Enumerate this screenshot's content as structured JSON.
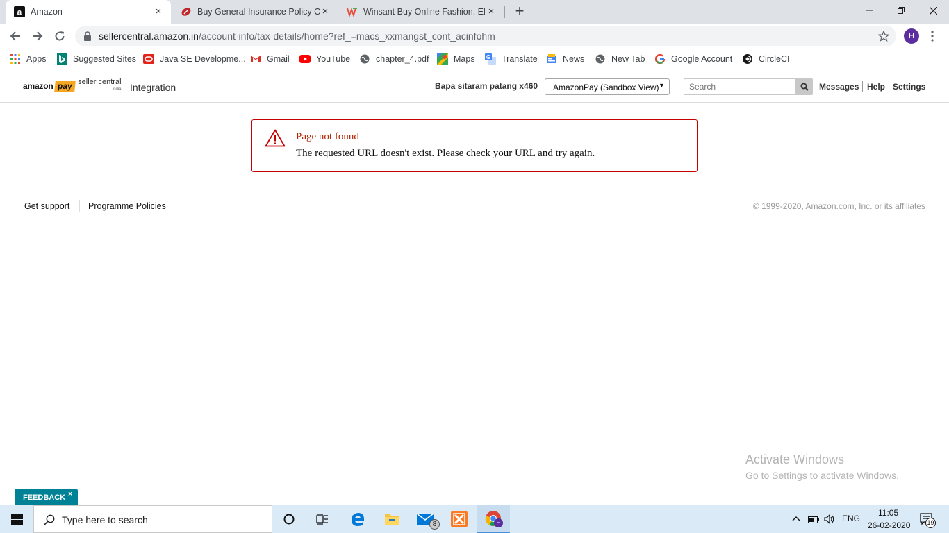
{
  "browser": {
    "tabs": [
      {
        "title": "Amazon",
        "active": true
      },
      {
        "title": "Buy General Insurance Policy Onl",
        "active": false
      },
      {
        "title": "Winsant Buy Online Fashion, Elec",
        "active": false
      }
    ],
    "new_tab_label": "+",
    "close_label": "×",
    "url_host": "sellercentral.amazon.in",
    "url_path": "/account-info/tax-details/home?ref_=macs_xxmangst_cont_acinfohm",
    "profile_initial": "H",
    "bookmarks": [
      {
        "label": "Apps",
        "icon": "apps-grid-icon"
      },
      {
        "label": "Suggested Sites",
        "icon": "bing-icon"
      },
      {
        "label": "Java SE Developme...",
        "icon": "oracle-icon"
      },
      {
        "label": "Gmail",
        "icon": "gmail-icon"
      },
      {
        "label": "YouTube",
        "icon": "youtube-icon"
      },
      {
        "label": "chapter_4.pdf",
        "icon": "globe-icon"
      },
      {
        "label": "Maps",
        "icon": "maps-icon"
      },
      {
        "label": "Translate",
        "icon": "translate-icon"
      },
      {
        "label": "News",
        "icon": "news-icon"
      },
      {
        "label": "New Tab",
        "icon": "globe-icon"
      },
      {
        "label": "Google Account",
        "icon": "google-icon"
      },
      {
        "label": "CircleCI",
        "icon": "circleci-icon"
      }
    ]
  },
  "header": {
    "logo_amazon": "amazon",
    "logo_pay": "pay",
    "logo_seller_central": "seller central",
    "logo_region": "India",
    "integration_label": "Integration",
    "account_name": "Bapa sitaram patang x460",
    "marketplace_selected": "AmazonPay (Sandbox View)",
    "search_placeholder": "Search",
    "links": [
      "Messages",
      "Help",
      "Settings"
    ]
  },
  "alert": {
    "title": "Page not found",
    "message": "The requested URL doesn't exist. Please check your URL and try again."
  },
  "footer": {
    "links": [
      "Get support",
      "Programme Policies"
    ],
    "copyright": "© 1999-2020, Amazon.com, Inc. or its affiliates"
  },
  "watermark": {
    "line1": "Activate Windows",
    "line2": "Go to Settings to activate Windows."
  },
  "feedback": {
    "label": "FEEDBACK",
    "close": "×"
  },
  "taskbar": {
    "search_placeholder": "Type here to search",
    "mail_badge": "8",
    "language": "ENG",
    "time": "11:05",
    "date": "26-02-2020",
    "notification_count": "19"
  },
  "colors": {
    "alert_border": "#c40000",
    "alert_title": "#b12704",
    "feedback_bg": "#008296",
    "pay_badge": "#f5a623",
    "taskbar_bg": "#dbeaf7",
    "tabstrip_bg": "#dee1e6"
  }
}
